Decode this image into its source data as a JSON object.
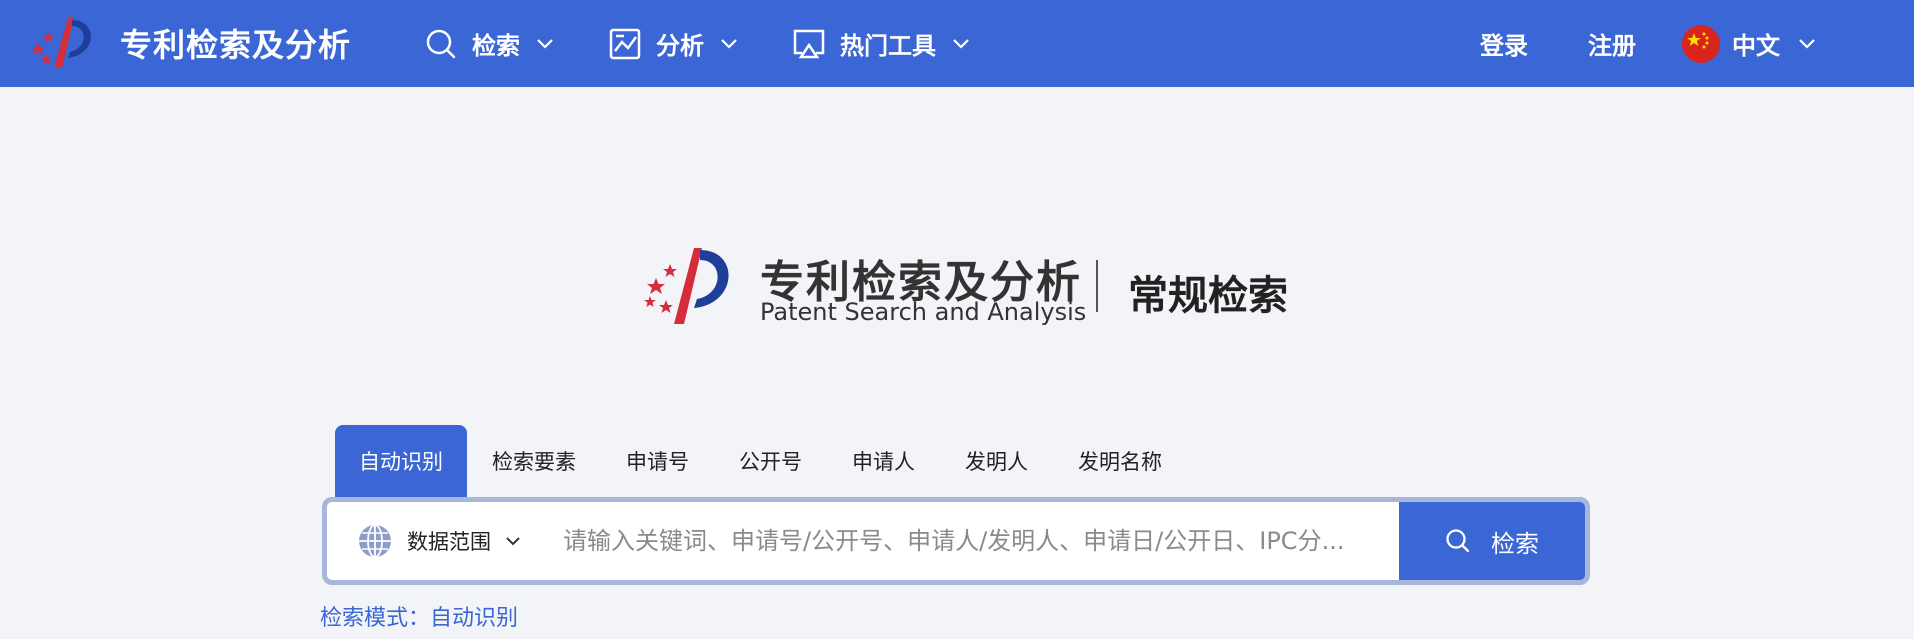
{
  "header": {
    "brand_title": "专利检索及分析",
    "nav": [
      {
        "label": "检索",
        "icon": "search-icon"
      },
      {
        "label": "分析",
        "icon": "chart-icon"
      },
      {
        "label": "热门工具",
        "icon": "screen-cast-icon"
      }
    ],
    "login_label": "登录",
    "register_label": "注册",
    "language_label": "中文"
  },
  "hero": {
    "logo_cn": "专利检索及分析",
    "logo_en": "Patent Search and Analysis",
    "subtitle": "常规检索"
  },
  "search": {
    "tabs": [
      "自动识别",
      "检索要素",
      "申请号",
      "公开号",
      "申请人",
      "发明人",
      "发明名称"
    ],
    "active_tab": 0,
    "scope_label": "数据范围",
    "placeholder": "请输入关键词、申请号/公开号、申请人/发明人、申请日/公开日、IPC分...",
    "button_label": "检索",
    "mode_label": "检索模式：自动识别"
  },
  "colors": {
    "primary": "#3a66d6",
    "background": "#f3f4f8",
    "search_border": "#a9b6dc"
  }
}
